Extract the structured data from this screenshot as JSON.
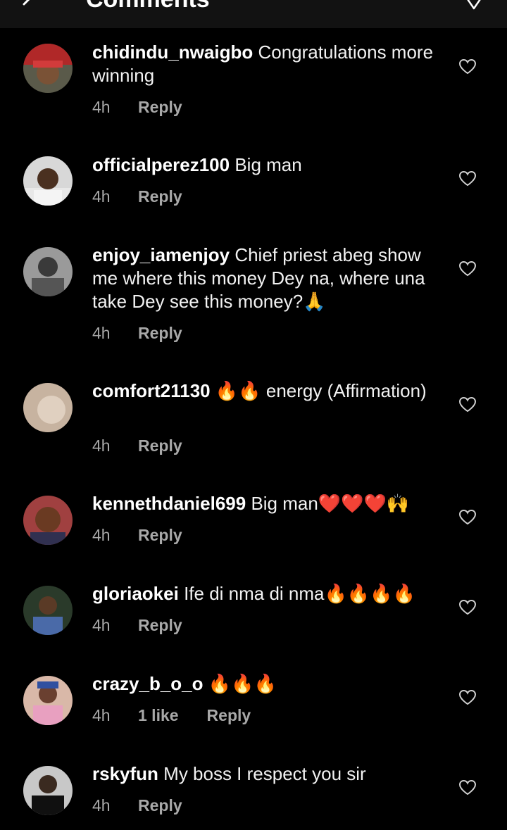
{
  "header": {
    "title": "Comments"
  },
  "comments": [
    {
      "username": "chidindu_nwaigbo",
      "text": "Congratulations more winning",
      "time": "4h",
      "likes": "",
      "reply_label": "Reply"
    },
    {
      "username": "officialperez100",
      "text": "Big man",
      "time": "4h",
      "likes": "",
      "reply_label": "Reply"
    },
    {
      "username": "enjoy_iamenjoy",
      "text": "Chief priest abeg show me where this money Dey na, where una take Dey see this money?🙏",
      "time": "4h",
      "likes": "",
      "reply_label": "Reply"
    },
    {
      "username": "comfort21130",
      "text": "🔥🔥 energy (Affirmation)",
      "time": "4h",
      "likes": "",
      "reply_label": "Reply"
    },
    {
      "username": "kennethdaniel699",
      "text": "Big man❤️❤️❤️🙌",
      "time": "4h",
      "likes": "",
      "reply_label": "Reply"
    },
    {
      "username": "gloriaokei",
      "text": "Ife di nma di nma🔥🔥🔥🔥",
      "time": "4h",
      "likes": "",
      "reply_label": "Reply"
    },
    {
      "username": "crazy_b_o_o",
      "text": "🔥🔥🔥",
      "time": "4h",
      "likes": "1 like",
      "reply_label": "Reply"
    },
    {
      "username": "rskyfun",
      "text": "My boss I respect you sir",
      "time": "4h",
      "likes": "",
      "reply_label": "Reply"
    }
  ],
  "icons": {
    "like": "heart-outline-icon",
    "back": "back-arrow-icon",
    "send": "send-icon"
  },
  "colors": {
    "background": "#000000",
    "header": "#121212",
    "meta_text": "#a8a8a8"
  }
}
